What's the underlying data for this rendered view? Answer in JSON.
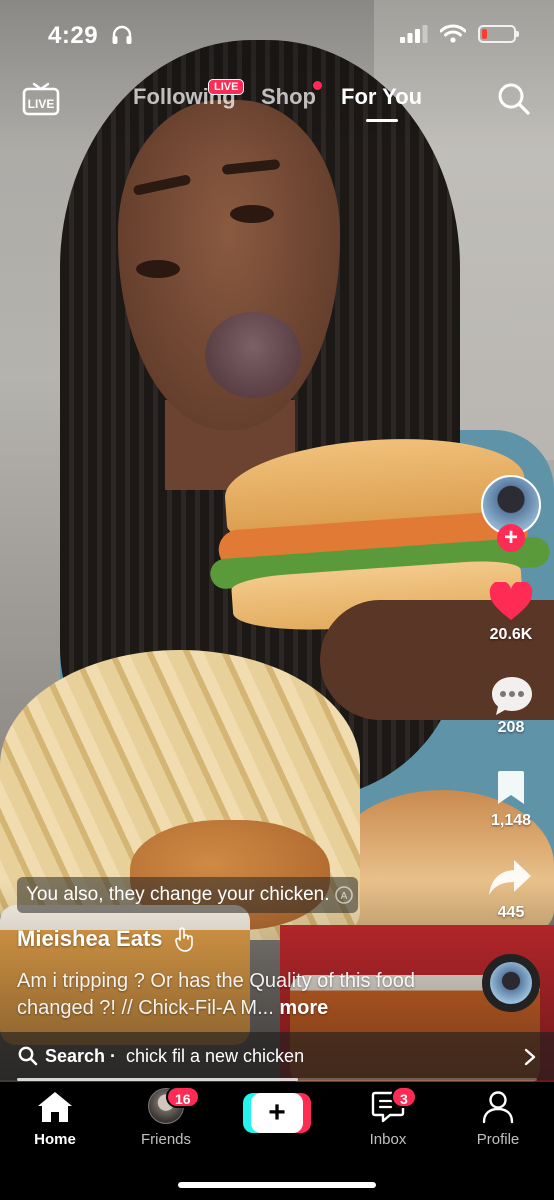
{
  "status_bar": {
    "time": "4:29",
    "battery_level": 0.15,
    "battery_color": "#ff3b30",
    "icons": [
      "headphones-icon",
      "cellular-signal-icon",
      "wifi-icon",
      "battery-icon"
    ]
  },
  "top_nav": {
    "live_icon_label": "LIVE",
    "tabs": [
      {
        "label": "Following",
        "active": false,
        "badge": "LIVE"
      },
      {
        "label": "Shop",
        "active": false,
        "dot": true
      },
      {
        "label": "For You",
        "active": true
      }
    ],
    "search_icon": "search-icon"
  },
  "video": {
    "sticker_text": "You also, they change your chicken.",
    "author": "Mieishea Eats",
    "caption": "Am i tripping ? Or has the Quality of this food changed ?! // Chick-Fil-A M...",
    "caption_more": "more",
    "progress": 0.54
  },
  "actions": {
    "follow_symbol": "+",
    "likes": "20.6K",
    "comments": "208",
    "saves": "1,148",
    "shares": "445",
    "like_color": "#fe2c55"
  },
  "search_suggestion": {
    "label": "Search ·",
    "query": "chick fil a new chicken"
  },
  "bottom_nav": {
    "items": [
      {
        "label": "Home",
        "icon": "home-icon",
        "active": true
      },
      {
        "label": "Friends",
        "icon": "friends-avatar",
        "badge": "16"
      },
      {
        "label": "",
        "icon": "create-plus-icon"
      },
      {
        "label": "Inbox",
        "icon": "inbox-icon",
        "badge": "3"
      },
      {
        "label": "Profile",
        "icon": "profile-icon"
      }
    ],
    "create_symbol": "+"
  },
  "colors": {
    "accent": "#fe2c55",
    "create_cyan": "#25f4ee",
    "background": "#000000"
  }
}
